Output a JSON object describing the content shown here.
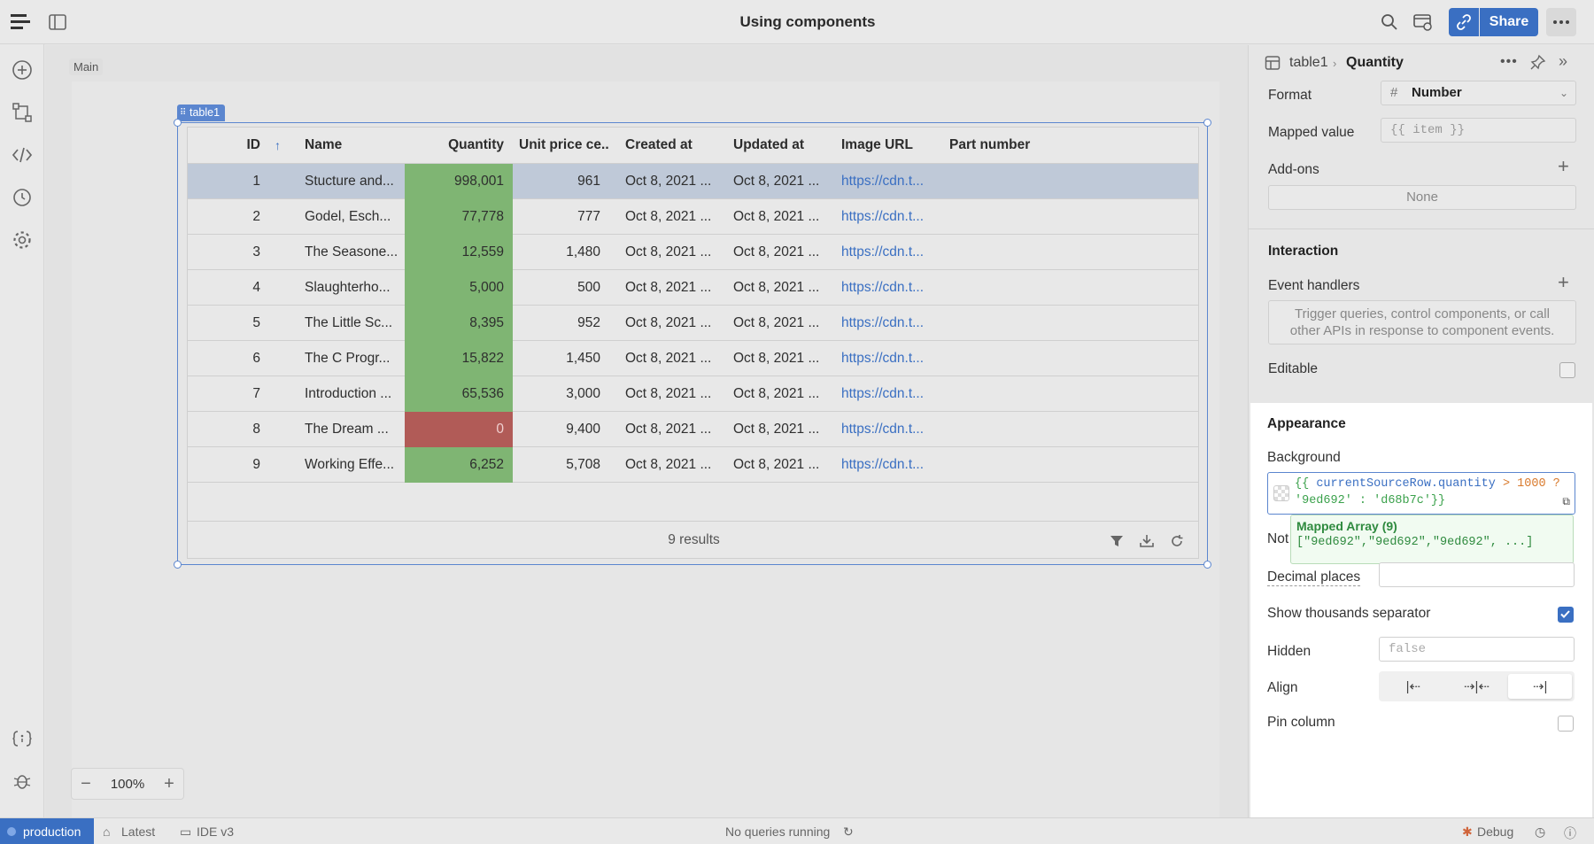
{
  "app": {
    "title": "Using components"
  },
  "topbar": {
    "share_label": "Share"
  },
  "canvas": {
    "main_label": "Main",
    "zoom": "100%"
  },
  "table": {
    "tag": "table1",
    "columns": [
      "ID",
      "Name",
      "Quantity",
      "Unit price ce...",
      "Created at",
      "Updated at",
      "Image URL",
      "Part number"
    ],
    "rows": [
      {
        "id": "1",
        "name": "Stucture and...",
        "quantity": "998,001",
        "unit_price": "961",
        "created": "Oct 8, 2021 ...",
        "updated": "Oct 8, 2021 ...",
        "url": "https://cdn.t...",
        "qty_color": "#7fb573",
        "selected": true
      },
      {
        "id": "2",
        "name": "Godel, Esch...",
        "quantity": "77,778",
        "unit_price": "777",
        "created": "Oct 8, 2021 ...",
        "updated": "Oct 8, 2021 ...",
        "url": "https://cdn.t...",
        "qty_color": "#7fb573"
      },
      {
        "id": "3",
        "name": "The Seasone...",
        "quantity": "12,559",
        "unit_price": "1,480",
        "created": "Oct 8, 2021 ...",
        "updated": "Oct 8, 2021 ...",
        "url": "https://cdn.t...",
        "qty_color": "#7fb573"
      },
      {
        "id": "4",
        "name": "Slaughterho...",
        "quantity": "5,000",
        "unit_price": "500",
        "created": "Oct 8, 2021 ...",
        "updated": "Oct 8, 2021 ...",
        "url": "https://cdn.t...",
        "qty_color": "#7fb573"
      },
      {
        "id": "5",
        "name": "The Little Sc...",
        "quantity": "8,395",
        "unit_price": "952",
        "created": "Oct 8, 2021 ...",
        "updated": "Oct 8, 2021 ...",
        "url": "https://cdn.t...",
        "qty_color": "#7fb573"
      },
      {
        "id": "6",
        "name": "The C Progr...",
        "quantity": "15,822",
        "unit_price": "1,450",
        "created": "Oct 8, 2021 ...",
        "updated": "Oct 8, 2021 ...",
        "url": "https://cdn.t...",
        "qty_color": "#7fb573"
      },
      {
        "id": "7",
        "name": "Introduction ...",
        "quantity": "65,536",
        "unit_price": "3,000",
        "created": "Oct 8, 2021 ...",
        "updated": "Oct 8, 2021 ...",
        "url": "https://cdn.t...",
        "qty_color": "#7fb573"
      },
      {
        "id": "8",
        "name": "The Dream ...",
        "quantity": "0",
        "unit_price": "9,400",
        "created": "Oct 8, 2021 ...",
        "updated": "Oct 8, 2021 ...",
        "url": "https://cdn.t...",
        "qty_color": "#b15b57"
      },
      {
        "id": "9",
        "name": "Working Effe...",
        "quantity": "6,252",
        "unit_price": "5,708",
        "created": "Oct 8, 2021 ...",
        "updated": "Oct 8, 2021 ...",
        "url": "https://cdn.t...",
        "qty_color": "#7fb573"
      }
    ],
    "results": "9 results"
  },
  "inspector": {
    "crumb_component": "table1",
    "crumb_column": "Quantity",
    "format_label": "Format",
    "format_value": "Number",
    "mapped_value_label": "Mapped value",
    "mapped_value_placeholder": "{{ item }}",
    "addons_label": "Add-ons",
    "addons_value": "None",
    "interaction_title": "Interaction",
    "event_handlers_label": "Event handlers",
    "event_handlers_hint": "Trigger queries, control components, or call other APIs in response to component events.",
    "editable_label": "Editable",
    "appearance": {
      "title": "Appearance",
      "background_label": "Background",
      "background_code_1": "{{ ",
      "background_code_var": "currentSourceRow.quantity",
      "background_code_op": " > 1000 ?",
      "background_code_2": "'9ed692' : 'd68b7c'}}",
      "mapped_title": "Mapped Array (9)",
      "mapped_values": "[\"9ed692\",\"9ed692\",\"9ed692\", ...]",
      "notation_label": "Not",
      "decimal_label": "Decimal places",
      "thousands_label": "Show thousands separator",
      "thousands_checked": true,
      "hidden_label": "Hidden",
      "hidden_placeholder": "false",
      "align_label": "Align",
      "pin_label": "Pin column"
    }
  },
  "statusbar": {
    "env": "production",
    "latest": "Latest",
    "ide": "IDE v3",
    "queries": "No queries running",
    "debug": "Debug"
  }
}
